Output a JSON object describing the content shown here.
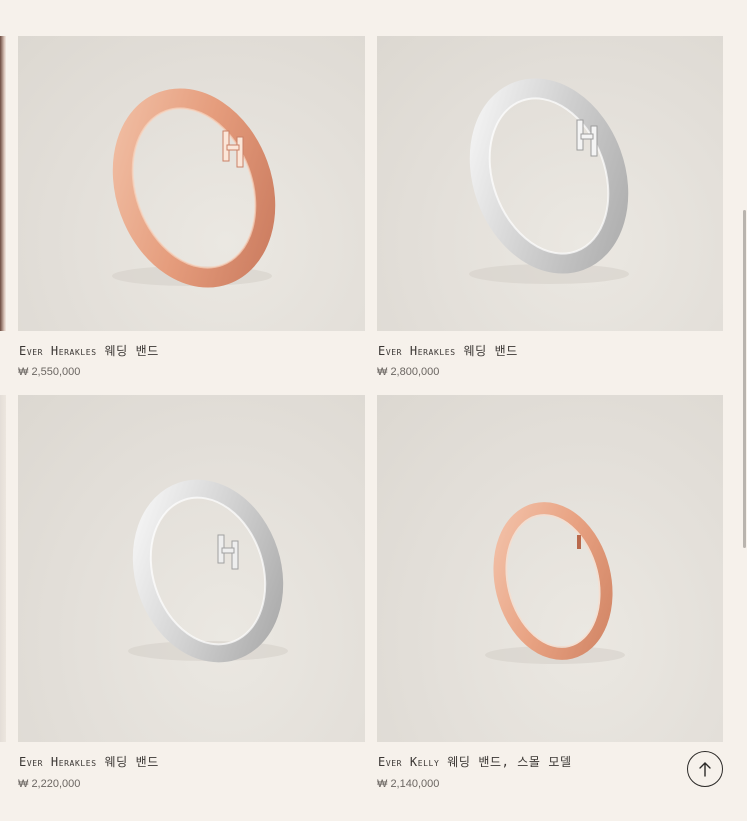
{
  "products": [
    {
      "name": "Ever Herakles 웨딩 밴드",
      "price": "₩ 2,550,000",
      "metal": "rose-gold",
      "image_icon": "ring-with-h-diamonds-icon"
    },
    {
      "name": "Ever Herakles 웨딩 밴드",
      "price": "₩ 2,800,000",
      "metal": "white-gold",
      "image_icon": "ring-with-h-diamonds-icon"
    },
    {
      "name": "Ever Herakles 웨딩 밴드",
      "price": "₩ 2,220,000",
      "metal": "white-gold",
      "image_icon": "ring-with-h-icon"
    },
    {
      "name": "Ever Kelly 웨딩 밴드, 스몰 모델",
      "price": "₩ 2,140,000",
      "metal": "rose-gold",
      "image_icon": "thin-ring-icon"
    }
  ],
  "back_to_top": {
    "icon": "arrow-up-icon"
  },
  "colors": {
    "background": "#f6f1eb",
    "image_bg": "#e2ded8",
    "rose_gold": "#e8a98c",
    "white_gold": "#dcdcdc"
  }
}
